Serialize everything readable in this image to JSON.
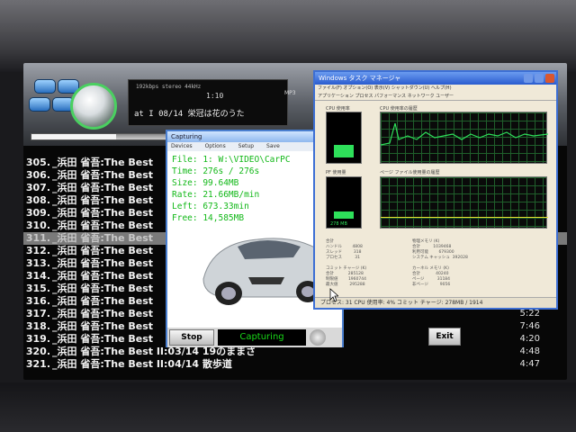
{
  "player": {
    "lcd_info": "192kbps stereo 44kHz",
    "time": "1:10",
    "track": "at I 08/14 栄冠は花のうた",
    "format": "MP3",
    "progress": 0.32
  },
  "playlist": {
    "rows": [
      {
        "num": "305.",
        "title": "_浜田 省吾:The Best",
        "dur": ""
      },
      {
        "num": "306.",
        "title": "_浜田 省吾:The Best",
        "dur": ""
      },
      {
        "num": "307.",
        "title": "_浜田 省吾:The Best",
        "dur": ""
      },
      {
        "num": "308.",
        "title": "_浜田 省吾:The Best",
        "dur": ""
      },
      {
        "num": "309.",
        "title": "_浜田 省吾:The Best",
        "dur": ""
      },
      {
        "num": "310.",
        "title": "_浜田 省吾:The Best",
        "dur": ""
      },
      {
        "num": "311.",
        "title": "_浜田 省吾:The Best",
        "dur": ""
      },
      {
        "num": "312.",
        "title": "_浜田 省吾:The Best",
        "dur": ""
      },
      {
        "num": "313.",
        "title": "_浜田 省吾:The Best",
        "dur": ""
      },
      {
        "num": "314.",
        "title": "_浜田 省吾:The Best",
        "dur": ""
      },
      {
        "num": "315.",
        "title": "_浜田 省吾:The Best",
        "dur": ""
      },
      {
        "num": "316.",
        "title": "_浜田 省吾:The Best",
        "dur": ""
      },
      {
        "num": "317.",
        "title": "_浜田 省吾:The Best",
        "dur": "5:22"
      },
      {
        "num": "318.",
        "title": "_浜田 省吾:The Best",
        "dur": "7:46"
      },
      {
        "num": "319.",
        "title": "_浜田 省吾:The Best",
        "dur": "4:20"
      },
      {
        "num": "320.",
        "title": "_浜田 省吾:The Best II:03/14 19のままさ",
        "dur": "4:48"
      },
      {
        "num": "321.",
        "title": "_浜田 省吾:The Best II:04/14 散歩道",
        "dur": "4:47"
      }
    ],
    "selected_index": 6
  },
  "capture": {
    "title": "Capturing",
    "menu": [
      "Devices",
      "Options",
      "Setup",
      "Save"
    ],
    "file": "File: 1: W:\\VIDEO\\CarPC",
    "time": "Time: 276s / 276s",
    "size": "Size: 99.64MB",
    "rate": "Rate: 21.66MB/min",
    "left": "Left: 673.33min",
    "free": "Free: 14,585MB",
    "stop_label": "Stop",
    "status_label": "Capturing",
    "exit_label": "Exit"
  },
  "taskmgr": {
    "title": "Windows タスク マネージャ",
    "menu": "ファイル(F)  オプション(O)  表示(V)  シャットダウン(U)  ヘルプ(H)",
    "tabs": "アプリケーション  プロセス  パフォーマンス  ネットワーク  ユーザー",
    "cpu_label": "CPU 使用率",
    "cpu_hist_label": "CPU 使用率の履歴",
    "pf_label": "PF 使用量",
    "pf_hist_label": "ページ ファイル使用量の履歴",
    "pf_value": "278 MB",
    "cpu_level": 0.3,
    "pf_level": 0.18,
    "status": "プロセス: 31   CPU 使用率: 4%   コミット チャージ: 278MB / 1914"
  },
  "colors": {
    "lcd_green": "#18d818",
    "tm_graph_green": "#2ee05a",
    "selected_row": "#7a7a7a"
  }
}
